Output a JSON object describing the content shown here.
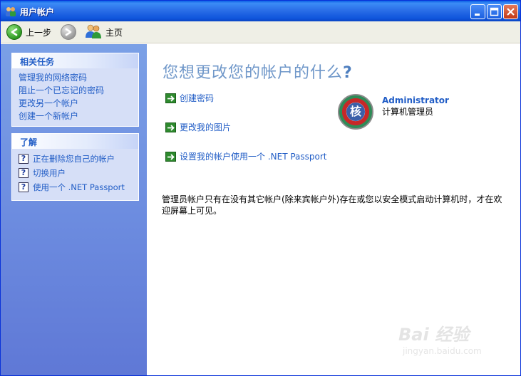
{
  "window": {
    "title": "用户帐户",
    "colors": {
      "titlebar": "#2b6fe8",
      "panel": "#6d8de0",
      "link": "#215dc6",
      "heading": "#6f97c9"
    }
  },
  "toolbar": {
    "back_label": "上一步",
    "home_label": "主页"
  },
  "sidebar": {
    "related_tasks": {
      "title": "相关任务",
      "items": [
        {
          "label": "管理我的网络密码"
        },
        {
          "label": "阻止一个已忘记的密码"
        },
        {
          "label": "更改另一个帐户"
        },
        {
          "label": "创建一个新帐户"
        }
      ]
    },
    "learn": {
      "title": "了解",
      "items": [
        {
          "label": "正在删除您自己的帐户",
          "icon": "help-icon"
        },
        {
          "label": "切换用户",
          "icon": "help-icon"
        },
        {
          "label": "使用一个 .NET Passport",
          "icon": "help-icon"
        }
      ]
    }
  },
  "main": {
    "heading": "您想更改您的帐户的什么",
    "heading_mark": "?",
    "actions": [
      {
        "label": "创建密码",
        "icon": "green-arrow-icon"
      },
      {
        "label": "更改我的图片",
        "icon": "green-arrow-icon"
      },
      {
        "label": "设置我的帐户使用一个 .NET Passport",
        "icon": "green-arrow-icon"
      }
    ],
    "account": {
      "name": "Administrator",
      "role": "计算机管理员",
      "avatar_glyph": "核"
    },
    "note": "管理员帐户只有在没有其它帐户(除来宾帐户外)存在或您以安全模式启动计算机时，才在欢迎屏幕上可见。"
  },
  "watermark": {
    "main": "Bai 经验",
    "sub": "jingyan.baidu.com"
  }
}
